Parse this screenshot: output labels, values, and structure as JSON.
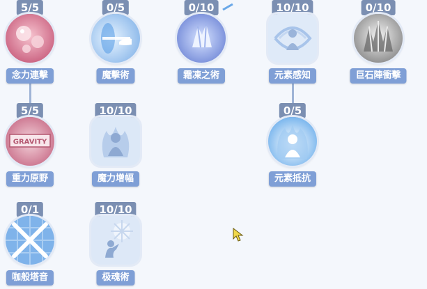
{
  "skills": [
    {
      "id": "telekinesis",
      "points": "5/5",
      "label": "念力連擊",
      "icon": "telekinesis-icon"
    },
    {
      "id": "magic-strike",
      "points": "0/5",
      "label": "魔擊術",
      "icon": "magic-strike-icon"
    },
    {
      "id": "frost",
      "points": "0/10",
      "label": "霜凍之術",
      "icon": "frost-icon"
    },
    {
      "id": "element-sense",
      "points": "10/10",
      "label": "元素感知",
      "icon": "element-sense-icon"
    },
    {
      "id": "boulder",
      "points": "0/10",
      "label": "巨石陣衝擊",
      "icon": "boulder-icon"
    },
    {
      "id": "gravity",
      "points": "5/5",
      "label": "重力原野",
      "icon": "gravity-icon",
      "icon_text": "GRAVITY"
    },
    {
      "id": "magic-boost",
      "points": "10/10",
      "label": "魔力增幅",
      "icon": "magic-boost-icon"
    },
    {
      "id": "element-resist",
      "points": "0/5",
      "label": "元素抵抗",
      "icon": "element-resist-icon"
    },
    {
      "id": "ka-tower",
      "points": "0/1",
      "label": "咖般塔音",
      "icon": "ka-tower-icon"
    },
    {
      "id": "soul",
      "points": "10/10",
      "label": "极魂術",
      "icon": "soul-icon"
    }
  ],
  "colors": {
    "badge": "#7b8fb2",
    "label_bg": "#7f9fd6",
    "connector": "#9fb4d6",
    "background": "#f4f7fc"
  }
}
